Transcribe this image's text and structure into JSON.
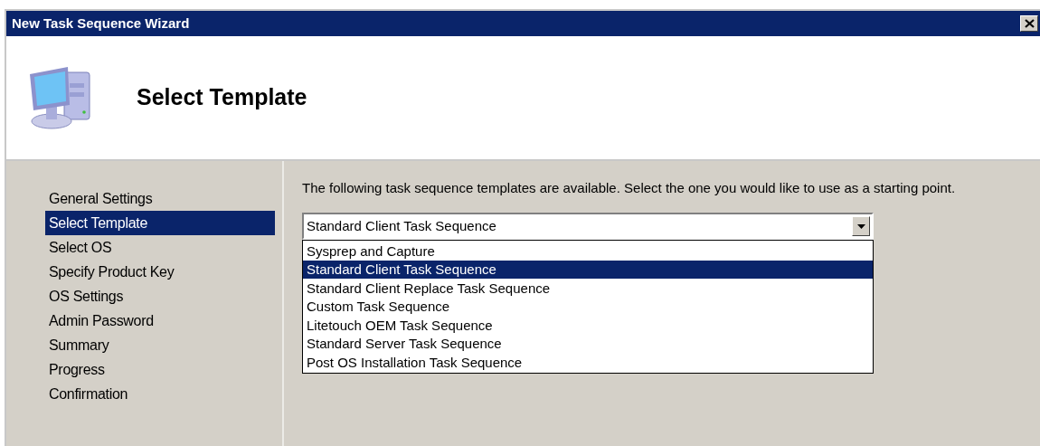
{
  "window": {
    "title": "New Task Sequence Wizard"
  },
  "header": {
    "title": "Select Template"
  },
  "steps": [
    {
      "label": "General Settings",
      "selected": false
    },
    {
      "label": "Select Template",
      "selected": true
    },
    {
      "label": "Select OS",
      "selected": false
    },
    {
      "label": "Specify Product Key",
      "selected": false
    },
    {
      "label": "OS Settings",
      "selected": false
    },
    {
      "label": "Admin Password",
      "selected": false
    },
    {
      "label": "Summary",
      "selected": false
    },
    {
      "label": "Progress",
      "selected": false
    },
    {
      "label": "Confirmation",
      "selected": false
    }
  ],
  "instructions": "The following task sequence templates are available.  Select the one you would like to use as a starting point.",
  "template_dropdown": {
    "value": "Standard Client Task Sequence",
    "expanded": true,
    "options": [
      {
        "label": "Sysprep and Capture",
        "selected": false
      },
      {
        "label": "Standard Client Task Sequence",
        "selected": true
      },
      {
        "label": "Standard Client Replace Task Sequence",
        "selected": false
      },
      {
        "label": "Custom Task Sequence",
        "selected": false
      },
      {
        "label": "Litetouch OEM Task Sequence",
        "selected": false
      },
      {
        "label": "Standard Server Task Sequence",
        "selected": false
      },
      {
        "label": "Post OS Installation Task Sequence",
        "selected": false
      }
    ]
  }
}
